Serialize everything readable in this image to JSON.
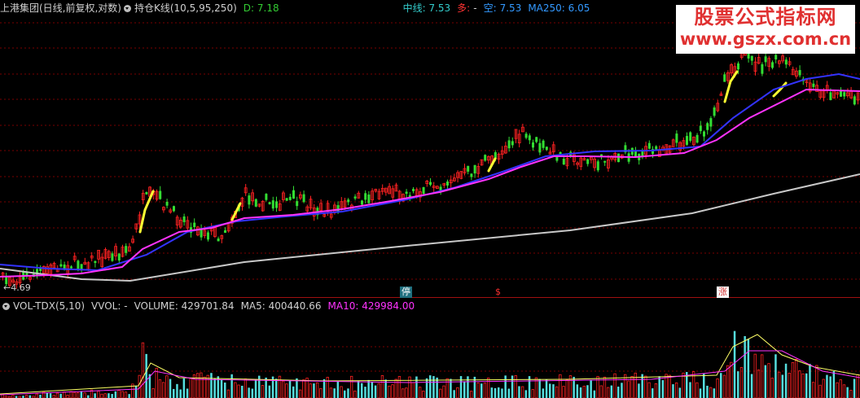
{
  "main": {
    "security_name": "上港集团(日线,前复权,对数)",
    "indicator_name": "持仓K线(10,5,95,250)",
    "d_value": "D: 7.18",
    "mid_line": "中线: 7.53",
    "duo_label": "多:",
    "duo_value": "-",
    "kong_label": "空:",
    "kong_value": "7.53",
    "ma250": "MA250: 6.05",
    "low_label": "←4.69",
    "markers": {
      "ting": "停",
      "dollar": "$",
      "zhang": "涨"
    }
  },
  "volume": {
    "indicator_name": "VOL-TDX(5,10)",
    "vvol": "VVOL: -",
    "volume": "VOLUME: 429701.84",
    "ma5": "MA5: 400440.66",
    "ma10": "MA10: 429984.00"
  },
  "watermark": {
    "title": "股票公式指标网",
    "url": "www.gszx.com.cn"
  },
  "colors": {
    "background": "#000000",
    "grid": "#7a0000",
    "up": "#ff2222",
    "down": "#33dd33",
    "ma_short": "#ff33ff",
    "ma_mid": "#3333ff",
    "ma250": "#c8c8c8",
    "highlight": "#ffff33"
  }
}
